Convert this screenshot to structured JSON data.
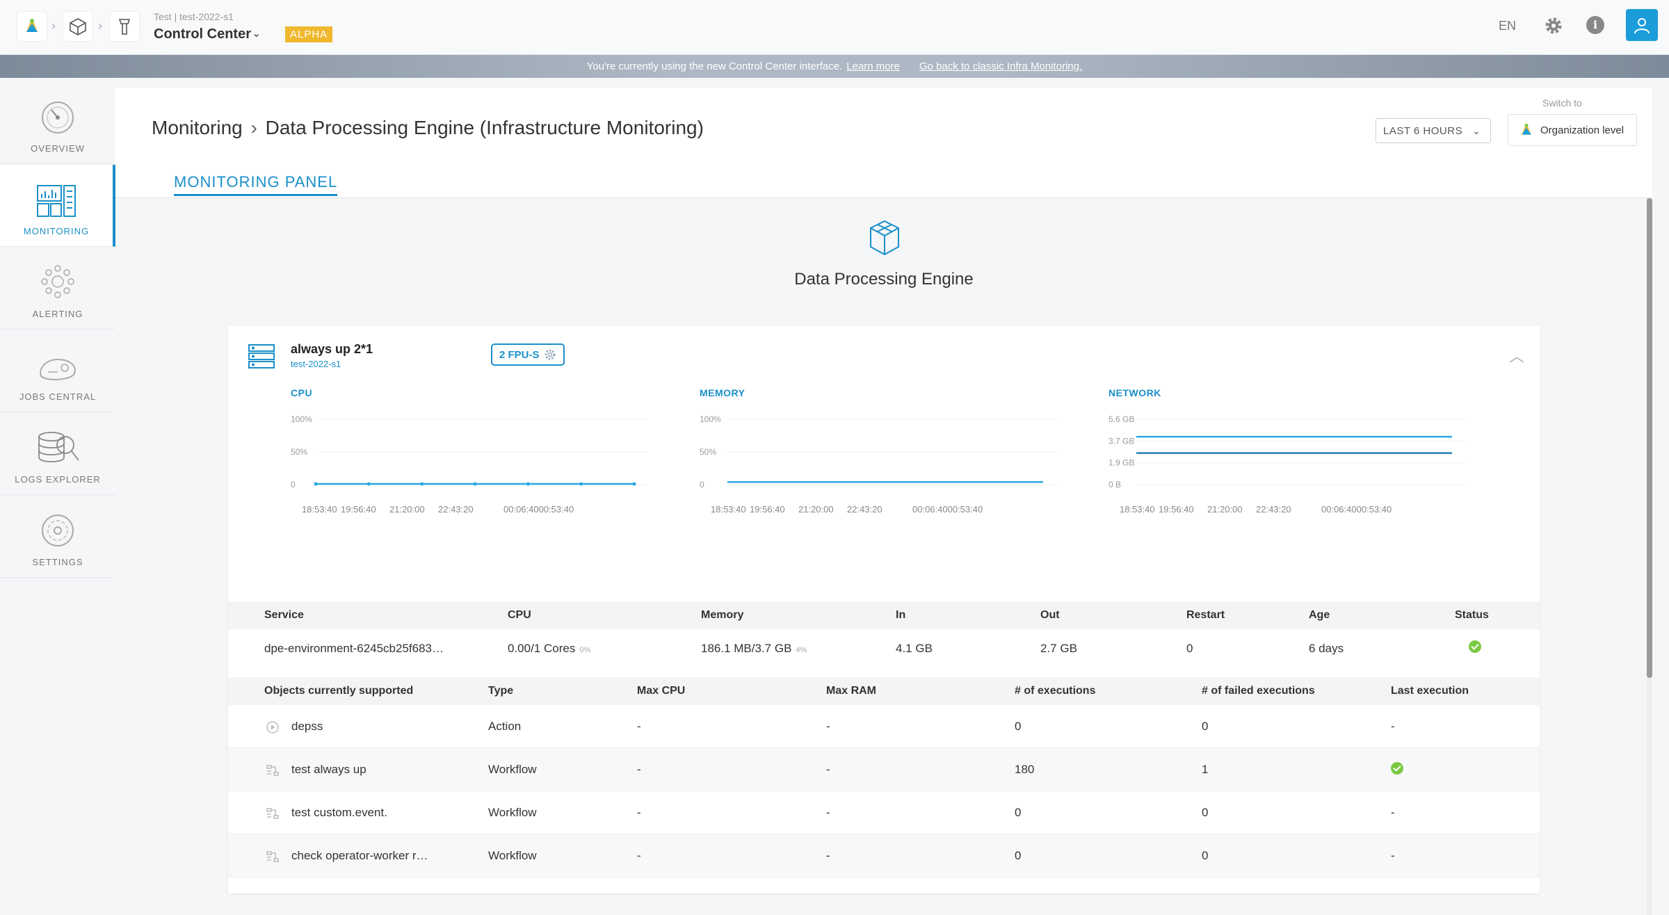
{
  "header": {
    "project_path": "Test | test-2022-s1",
    "app_name": "Control Center",
    "badge": "ALPHA",
    "lang": "EN"
  },
  "banner": {
    "text": "You're currently using the new Control Center interface.",
    "learn_more": "Learn more",
    "go_back": "Go back to classic Infra Monitoring."
  },
  "sidebar": {
    "items": [
      {
        "label": "OVERVIEW",
        "icon": "gauge-icon"
      },
      {
        "label": "MONITORING",
        "icon": "monitoring-icon"
      },
      {
        "label": "ALERTING",
        "icon": "alerting-icon"
      },
      {
        "label": "JOBS CENTRAL",
        "icon": "jobs-icon"
      },
      {
        "label": "LOGS EXPLORER",
        "icon": "logs-icon"
      },
      {
        "label": "SETTINGS",
        "icon": "settings-icon"
      }
    ]
  },
  "page": {
    "breadcrumb_root": "Monitoring",
    "breadcrumb_leaf": "Data Processing Engine (Infrastructure Monitoring)",
    "time_range": "LAST 6 HOURS",
    "switch_to": "Switch to",
    "org_level": "Organization level",
    "tab": "MONITORING PANEL",
    "engine_title": "Data Processing Engine"
  },
  "environment": {
    "name": "always up 2*1",
    "project": "test-2022-s1",
    "fpu": "2 FPU-S"
  },
  "charts": [
    {
      "title": "CPU",
      "yticks": [
        "100%",
        "50%",
        "0"
      ],
      "xticks": [
        "18:53:40",
        "19:56:40",
        "21:20:00",
        "22:43:20",
        "00:06:4000:53:40"
      ]
    },
    {
      "title": "MEMORY",
      "yticks": [
        "100%",
        "50%",
        "0"
      ],
      "xticks": [
        "18:53:40",
        "19:56:40",
        "21:20:00",
        "22:43:20",
        "00:06:4000:53:40"
      ]
    },
    {
      "title": "NETWORK",
      "yticks": [
        "5.6 GB",
        "3.7 GB",
        "1.9 GB",
        "0 B"
      ],
      "xticks": [
        "18:53:40",
        "19:56:40",
        "21:20:00",
        "22:43:20",
        "00:06:4000:53:40"
      ]
    }
  ],
  "chart_data": [
    {
      "type": "line",
      "title": "CPU",
      "ylim": [
        0,
        100
      ],
      "series": [
        {
          "values": [
            1,
            1,
            1,
            1,
            1,
            1,
            1
          ]
        }
      ]
    },
    {
      "type": "line",
      "title": "MEMORY",
      "ylim": [
        0,
        100
      ],
      "series": [
        {
          "values": [
            4,
            4,
            4,
            4,
            4,
            4
          ]
        }
      ]
    },
    {
      "type": "line",
      "title": "NETWORK",
      "ylim": [
        0,
        5.6
      ],
      "series": [
        {
          "values": [
            4.1,
            4.1,
            4.1
          ]
        },
        {
          "values": [
            2.7,
            2.7,
            2.7
          ]
        }
      ]
    }
  ],
  "service_table": {
    "headers": [
      "Service",
      "CPU",
      "Memory",
      "In",
      "Out",
      "Restart",
      "Age",
      "Status"
    ],
    "row": {
      "service": "dpe-environment-6245cb25f683…",
      "cpu": "0.00/1 Cores",
      "cpu_pct": "0%",
      "memory": "186.1 MB/3.7 GB",
      "mem_pct": "4%",
      "in": "4.1 GB",
      "out": "2.7 GB",
      "restart": "0",
      "age": "6 days"
    }
  },
  "objects_table": {
    "headers": [
      "Objects currently supported",
      "Type",
      "Max CPU",
      "Max RAM",
      "# of executions",
      "# of failed executions",
      "Last execution"
    ],
    "rows": [
      {
        "name": "depss",
        "type": "Action",
        "max_cpu": "-",
        "max_ram": "-",
        "executions": "0",
        "failed": "0",
        "last": "-"
      },
      {
        "name": "test always up",
        "type": "Workflow",
        "max_cpu": "-",
        "max_ram": "-",
        "executions": "180",
        "failed": "1",
        "last": ""
      },
      {
        "name": "test custom.event.",
        "type": "Workflow",
        "max_cpu": "-",
        "max_ram": "-",
        "executions": "0",
        "failed": "0",
        "last": "-"
      },
      {
        "name": "check operator-worker r…",
        "type": "Workflow",
        "max_cpu": "-",
        "max_ram": "-",
        "executions": "0",
        "failed": "0",
        "last": "-"
      }
    ]
  }
}
